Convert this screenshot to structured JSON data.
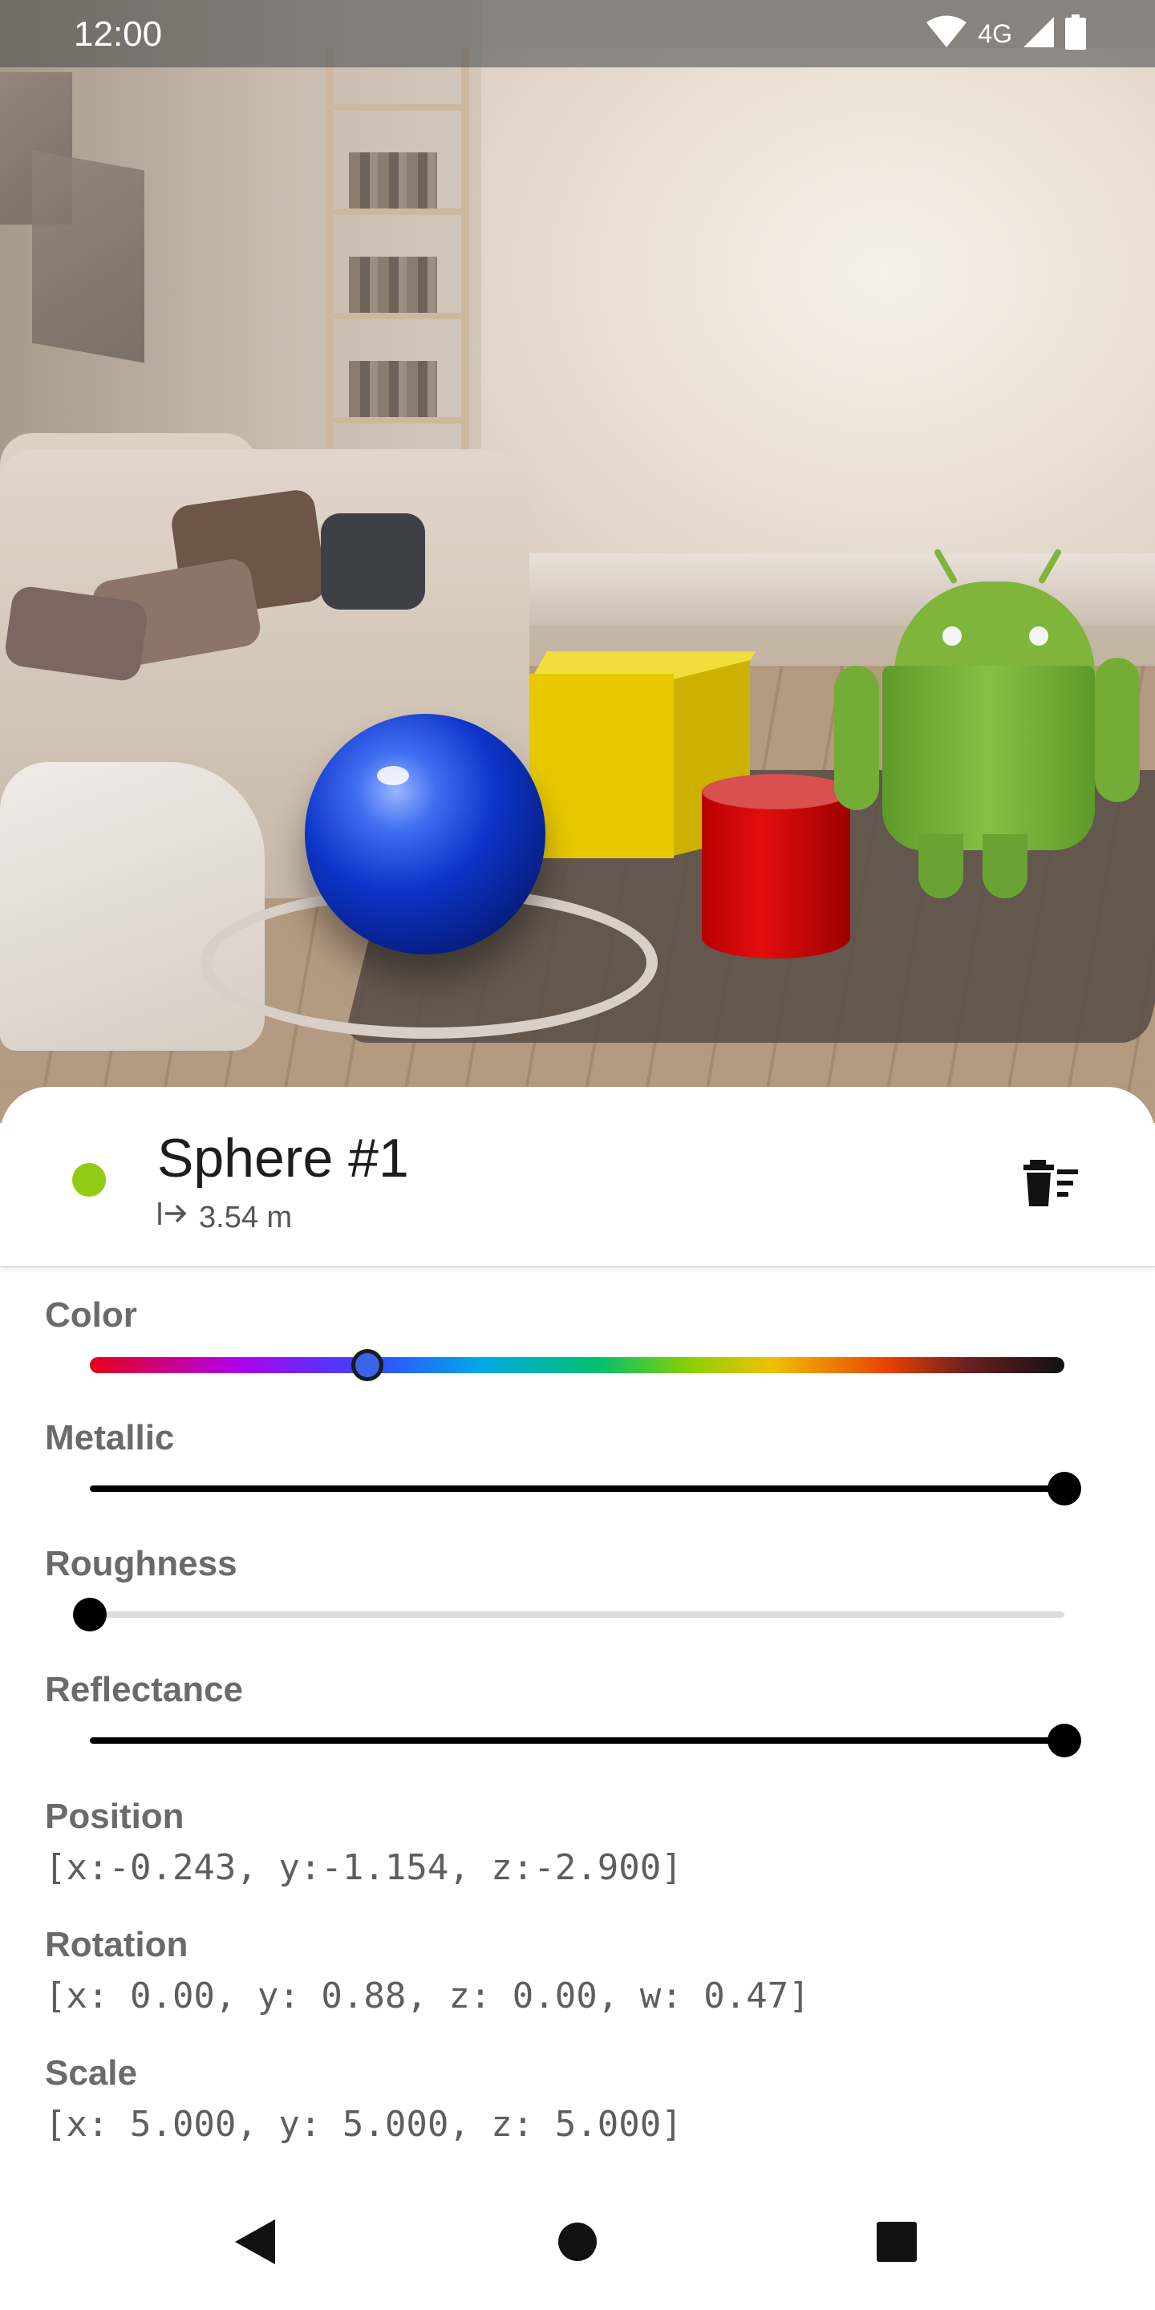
{
  "status_bar": {
    "time": "12:00",
    "network_label": "4G",
    "icons": [
      "wifi-icon",
      "cellular-signal-icon",
      "battery-icon"
    ]
  },
  "scene": {
    "objects": [
      "sphere",
      "cube",
      "cylinder",
      "android-robot"
    ],
    "colors": {
      "sphere": "#0c34c8",
      "cube": "#e8c900",
      "cylinder": "#e30d0d",
      "android": "#7fb53a"
    }
  },
  "header": {
    "title": "Sphere #1",
    "distance": "3.54 m",
    "status_color": "#8fcc13",
    "distance_icon": "arrow-right-from-bar-icon",
    "delete_icon": "delete-sweep-icon"
  },
  "properties": {
    "color": {
      "label": "Color",
      "hue_fraction": 0.285
    },
    "metallic": {
      "label": "Metallic",
      "value": 1.0
    },
    "roughness": {
      "label": "Roughness",
      "value": 0.0
    },
    "reflectance": {
      "label": "Reflectance",
      "value": 1.0
    }
  },
  "transform": {
    "position_label": "Position",
    "position_value": "[x:-0.243, y:-1.154, z:-2.900]",
    "rotation_label": "Rotation",
    "rotation_value": "[x: 0.00, y: 0.88, z: 0.00, w: 0.47]",
    "scale_label": "Scale",
    "scale_value": "[x: 5.000, y: 5.000, z: 5.000]"
  },
  "nav_bar": {
    "buttons": [
      "back-icon",
      "home-icon",
      "recents-icon"
    ]
  }
}
